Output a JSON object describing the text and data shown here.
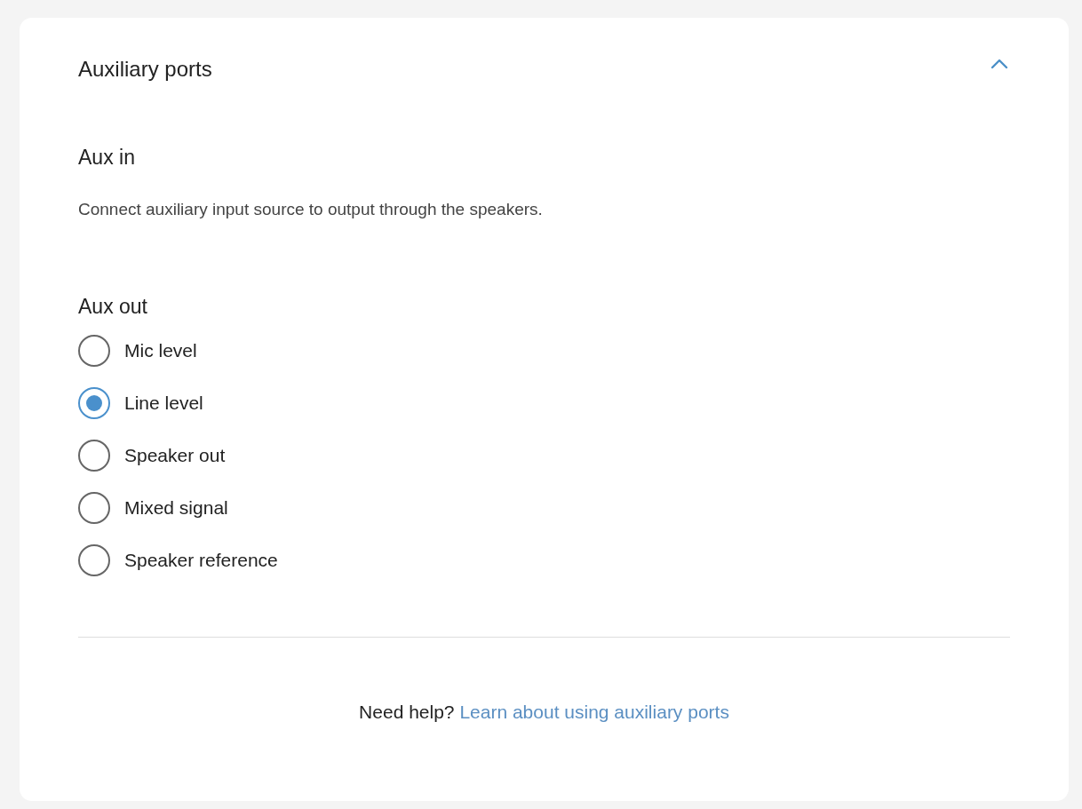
{
  "panel": {
    "title": "Auxiliary ports",
    "expanded": true
  },
  "aux_in": {
    "heading": "Aux in",
    "description": "Connect auxiliary input source to output through the speakers."
  },
  "aux_out": {
    "heading": "Aux out",
    "options": [
      {
        "label": "Mic level",
        "selected": false
      },
      {
        "label": "Line level",
        "selected": true
      },
      {
        "label": "Speaker out",
        "selected": false
      },
      {
        "label": "Mixed signal",
        "selected": false
      },
      {
        "label": "Speaker reference",
        "selected": false
      }
    ]
  },
  "help": {
    "prompt": "Need help?",
    "link": "Learn about using auxiliary ports"
  }
}
